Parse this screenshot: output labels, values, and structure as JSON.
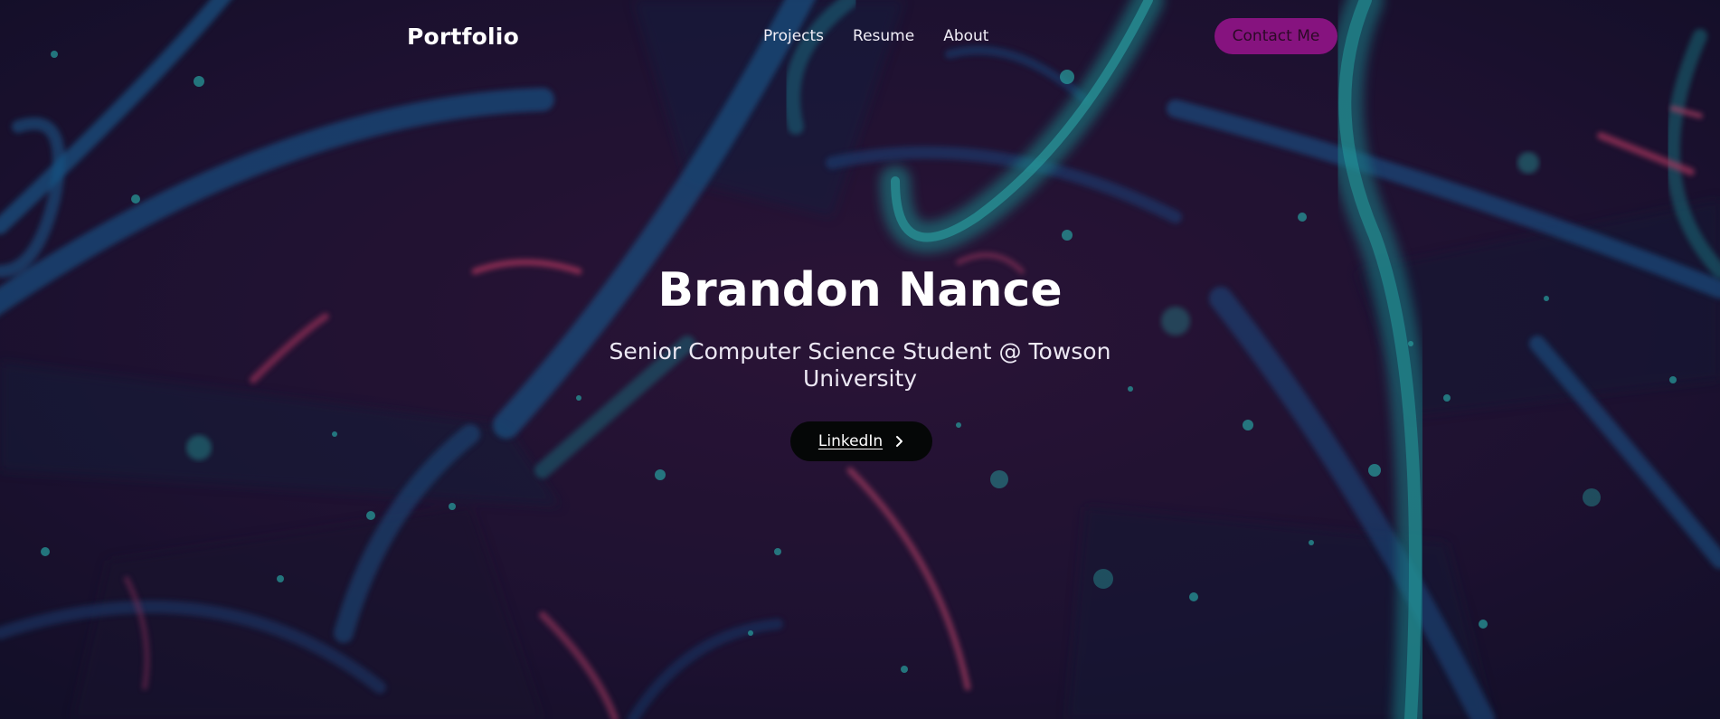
{
  "header": {
    "brand": "Portfolio",
    "nav": [
      {
        "label": "Projects"
      },
      {
        "label": "Resume"
      },
      {
        "label": "About"
      }
    ],
    "contact_label": "Contact Me"
  },
  "hero": {
    "name": "Brandon Nance",
    "subtitle": "Senior Computer Science Student @ Towson University",
    "linkedin_label": "LinkedIn",
    "linkedin_icon": "chevron-right-icon"
  },
  "colors": {
    "contact_button": "#86137f",
    "linkedin_button": "#050707",
    "teal_accent": "#1fb5b0",
    "pink_accent": "#d9416f",
    "background": "#1a0f2e"
  }
}
